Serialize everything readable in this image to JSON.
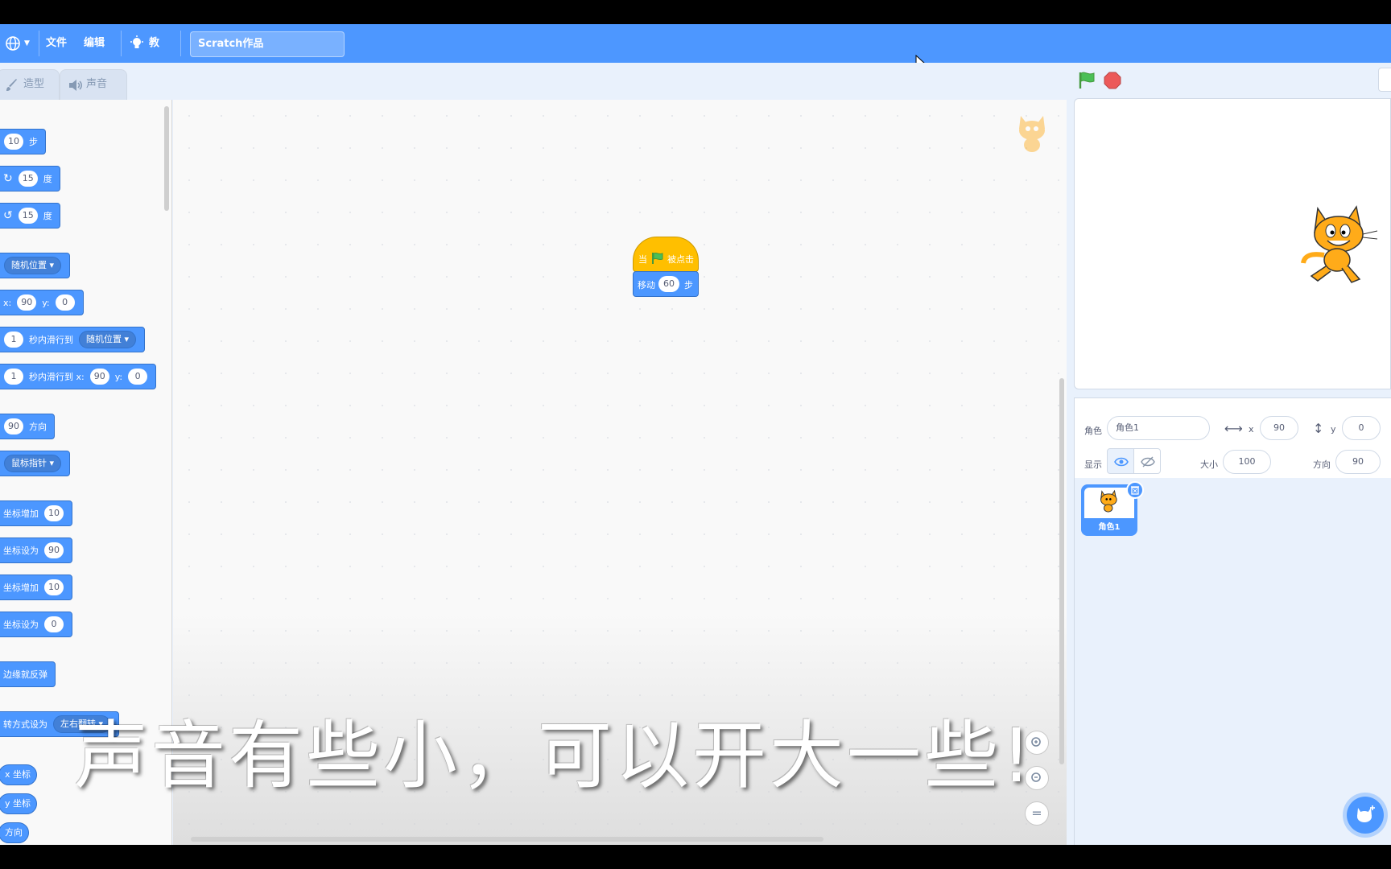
{
  "menubar": {
    "file": "文件",
    "edit": "编辑",
    "tutorials": "教程",
    "project_title": "Scratch作品"
  },
  "tabs": {
    "costumes": "造型",
    "sounds": "声音"
  },
  "palette": {
    "move_steps": "10",
    "move_unit": "步",
    "turn_right_deg": "15",
    "turn_left_deg": "15",
    "deg_unit": "度",
    "goto_random": "随机位置",
    "goto_x_label": "x:",
    "goto_x": "90",
    "goto_y_label": "y:",
    "goto_y": "0",
    "glide1_secs": "1",
    "glide1_text": "秒内滑行到",
    "glide1_target": "随机位置",
    "glide2_secs": "1",
    "glide2_text": "秒内滑行到 x:",
    "glide2_x": "90",
    "glide2_y_label": "y:",
    "glide2_y": "0",
    "dir_value": "90",
    "dir_text": "方向",
    "point_towards": "鼠标指针",
    "change_x_text": "坐标增加",
    "change_x": "10",
    "set_x_text": "坐标设为",
    "set_x": "90",
    "change_y_text": "坐标增加",
    "change_y": "10",
    "set_y_text": "坐标设为",
    "set_y": "0",
    "bounce": "边缘就反弹",
    "rotation_text": "转方式设为",
    "rotation_value": "左右翻转",
    "rep_x": "x 坐标",
    "rep_y": "y 坐标",
    "rep_dir": "方向"
  },
  "script": {
    "hat_when": "当",
    "hat_clicked": "被点击",
    "move_label": "移动",
    "move_value": "60",
    "move_unit": "步"
  },
  "zoom": {
    "reset": "="
  },
  "sprite_info": {
    "sprite_label": "角色",
    "sprite_name": "角色1",
    "x_label": "x",
    "x_value": "90",
    "y_label": "y",
    "y_value": "0",
    "show_label": "显示",
    "size_label": "大小",
    "size_value": "100",
    "direction_label": "方向",
    "direction_value": "90"
  },
  "sprites": [
    {
      "name": "角色1"
    }
  ],
  "subtitle": "声音有些小，可以开大一些!",
  "colors": {
    "menubar": "#4d97ff",
    "motion": "#4c97ff",
    "events": "#ffbf00",
    "green_flag": "#45b336",
    "stop": "#ec5959"
  }
}
